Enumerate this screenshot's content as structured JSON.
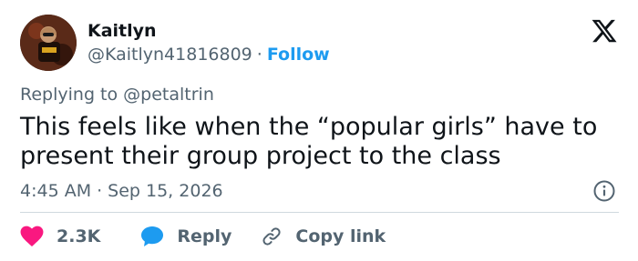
{
  "author": {
    "name": "Kaitlyn",
    "handle": "@Kaitlyn41816809",
    "separator": "·",
    "follow_label": "Follow"
  },
  "reply_context": {
    "prefix": "Replying to",
    "mention": "@petaltrin"
  },
  "tweet": {
    "text": "This feels like when the “popular girls” have to present their group project to the class",
    "time": "4:45 AM",
    "separator": "·",
    "date": "Sep 15, 2026"
  },
  "actions": {
    "like_count": "2.3K",
    "reply_label": "Reply",
    "copy_link_label": "Copy link"
  },
  "icons": {
    "brand": "x-logo-icon",
    "info": "info-icon",
    "like": "heart-icon",
    "reply": "speech-bubble-icon",
    "copy": "link-icon"
  },
  "colors": {
    "text": "#0f1419",
    "secondary": "#536471",
    "accent": "#1d9bf0",
    "like": "#f91880",
    "divider": "#cfd9de"
  }
}
